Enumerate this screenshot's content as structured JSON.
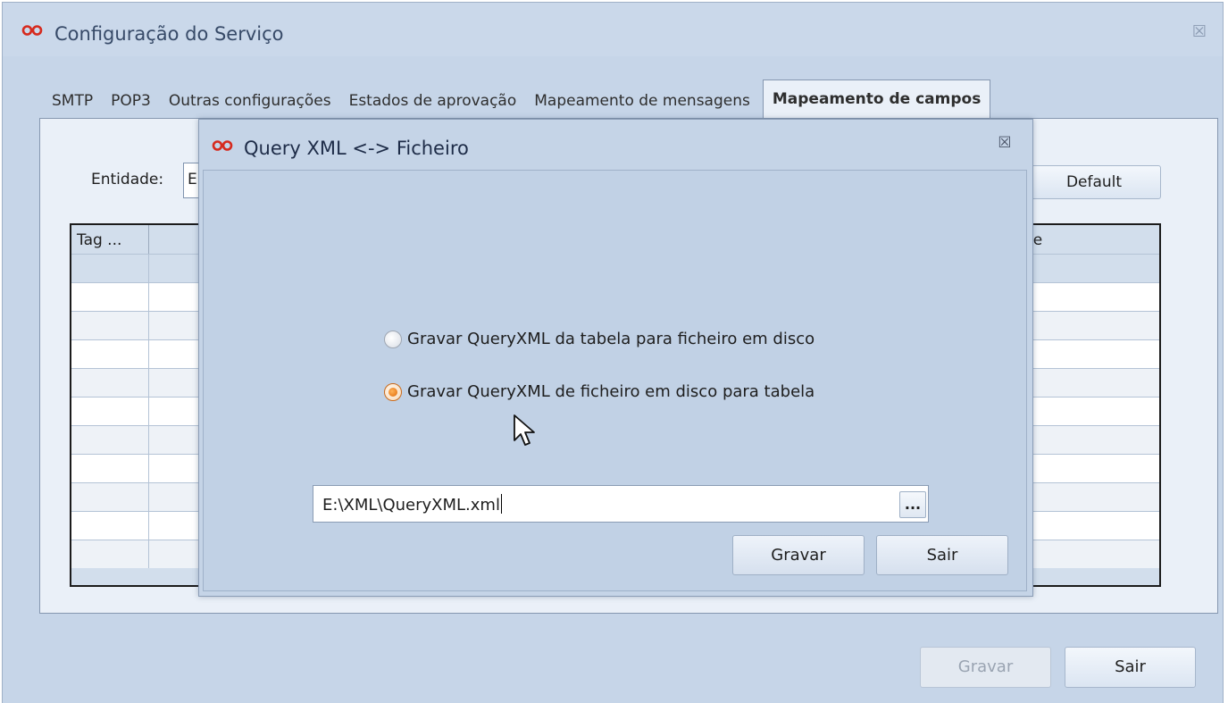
{
  "main_window": {
    "title": "Configuração do Serviço",
    "logo_icon": "red-infinity-logo-icon",
    "close_glyph": "☒"
  },
  "tabs": [
    {
      "label": "SMTP",
      "active": false
    },
    {
      "label": "POP3",
      "active": false
    },
    {
      "label": "Outras configurações",
      "active": false
    },
    {
      "label": "Estados de aprovação",
      "active": false
    },
    {
      "label": "Mapeamento de mensagens",
      "active": false
    },
    {
      "label": "Mapeamento de campos",
      "active": true
    }
  ],
  "panel": {
    "entidade_label": "Entidade:",
    "entidade_value": "E",
    "default_button": "Default",
    "grid": {
      "columns": [
        "Tag ...",
        "",
        "ne"
      ]
    }
  },
  "dialog": {
    "title": "Query XML <-> Ficheiro",
    "close_glyph": "☒",
    "options": [
      {
        "label": "Gravar QueryXML da tabela para ficheiro em disco",
        "selected": false
      },
      {
        "label": "Gravar QueryXML de ficheiro em disco para tabela",
        "selected": true
      }
    ],
    "path_value": "E:\\XML\\QueryXML.xml",
    "browse_label": "...",
    "gravar_button": "Gravar",
    "sair_button": "Sair"
  },
  "footer": {
    "gravar_button": "Gravar",
    "gravar_enabled": false,
    "sair_button": "Sair"
  },
  "colors": {
    "window_bg": "#c6d5e8",
    "panel_bg": "#eaf0f8",
    "radio_selected": "#e06a08",
    "logo_red": "#d62a1e"
  }
}
